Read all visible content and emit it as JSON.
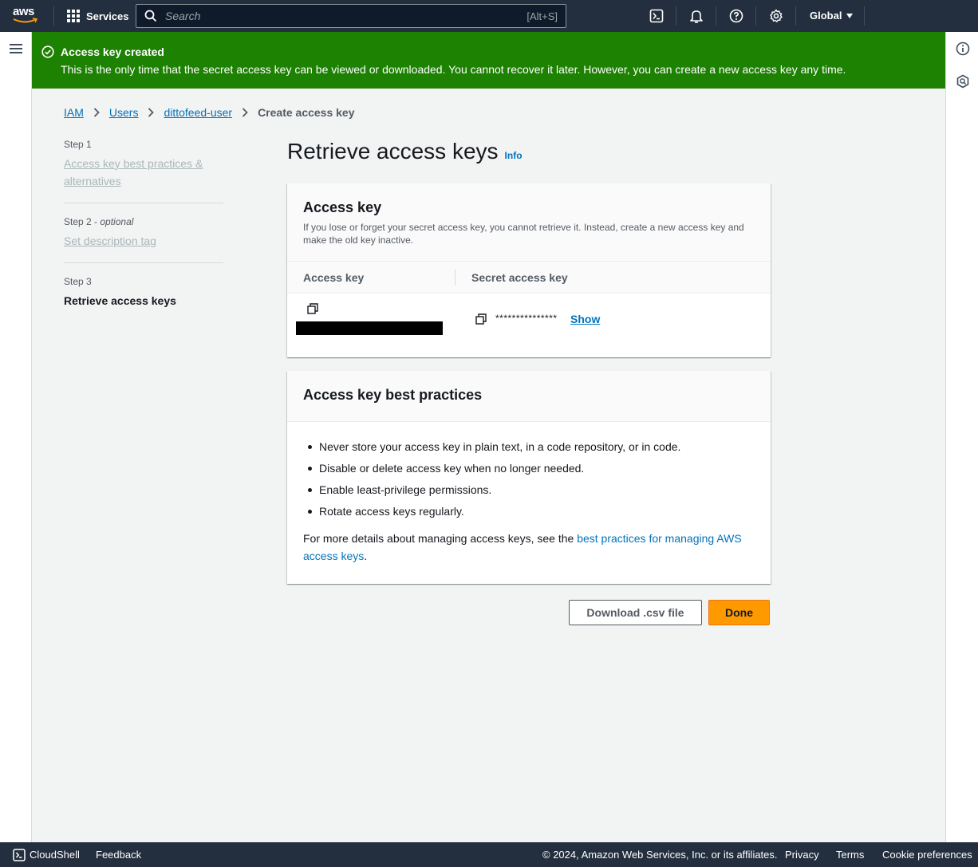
{
  "topnav": {
    "logo": "aws",
    "services_label": "Services",
    "search_placeholder": "Search",
    "search_shortcut": "[Alt+S]",
    "region_label": "Global"
  },
  "flash": {
    "title": "Access key created",
    "message": "This is the only time that the secret access key can be viewed or downloaded. You cannot recover it later. However, you can create a new access key any time."
  },
  "breadcrumb": {
    "items": [
      "IAM",
      "Users",
      "dittofeed-user"
    ],
    "current": "Create access key"
  },
  "steps": [
    {
      "label": "Step 1",
      "name": "Access key best practices & alternatives"
    },
    {
      "label": "Step 2",
      "optional": "optional",
      "name": "Set description tag"
    },
    {
      "label": "Step 3",
      "name": "Retrieve access keys"
    }
  ],
  "page": {
    "title": "Retrieve access keys",
    "info_link": "Info"
  },
  "access_key_panel": {
    "title": "Access key",
    "description": "If you lose or forget your secret access key, you cannot retrieve it. Instead, create a new access key and make the old key inactive.",
    "col_access_key": "Access key",
    "col_secret_key": "Secret access key",
    "secret_masked": "***************",
    "show_link": "Show"
  },
  "best_practices_panel": {
    "title": "Access key best practices",
    "items": [
      "Never store your access key in plain text, in a code repository, or in code.",
      "Disable or delete access key when no longer needed.",
      "Enable least-privilege permissions.",
      "Rotate access keys regularly."
    ],
    "details_prefix": "For more details about managing access keys, see the ",
    "details_link": "best practices for managing AWS access keys",
    "details_suffix": "."
  },
  "actions": {
    "download_label": "Download .csv file",
    "done_label": "Done"
  },
  "footer": {
    "cloudshell": "CloudShell",
    "feedback": "Feedback",
    "copyright": "© 2024, Amazon Web Services, Inc. or its affiliates.",
    "privacy": "Privacy",
    "terms": "Terms",
    "cookie_preferences": "Cookie preferences"
  },
  "colors": {
    "nav_bg": "#232f3e",
    "success_green": "#1d8102",
    "link_blue": "#0073bb",
    "primary_orange": "#ff9900"
  },
  "icons": [
    "aws-logo-icon",
    "services-grid-icon",
    "search-icon",
    "cloudshell-icon",
    "notifications-bell-icon",
    "help-icon",
    "settings-gear-icon",
    "menu-icon",
    "info-icon",
    "security-hub-icon",
    "success-check-icon",
    "chevron-right-icon",
    "copy-icon"
  ]
}
